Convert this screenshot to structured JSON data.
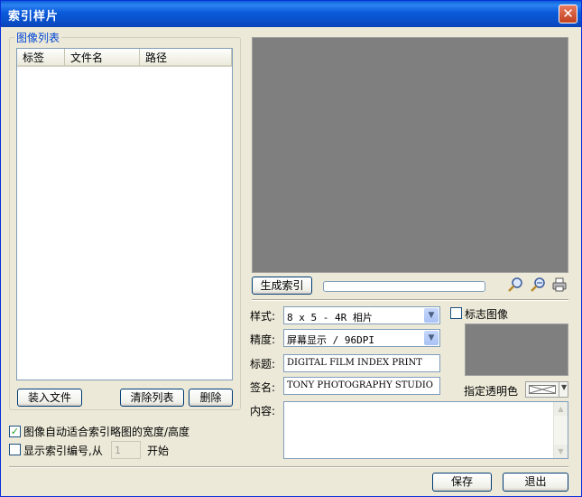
{
  "window": {
    "title": "索引样片",
    "close_glyph": "✕"
  },
  "image_list": {
    "group_label": "图像列表",
    "columns": [
      "标签",
      "文件名",
      "路径"
    ],
    "rows": []
  },
  "list_buttons": {
    "load": "装入文件",
    "clear": "清除列表",
    "delete": "删除"
  },
  "options": {
    "auto_fit_label": "图像自动适合索引略图的宽度/高度",
    "auto_fit_checked": true,
    "show_index_label": "显示索引编号,从",
    "show_index_checked": false,
    "start_value": "1",
    "start_suffix": "开始"
  },
  "preview": {
    "generate_button": "生成索引",
    "progress": 0
  },
  "form": {
    "style_label": "样式:",
    "style_value": "8 x 5 - 4R 相片",
    "precision_label": "精度:",
    "precision_value": "屏幕显示 / 96DPI",
    "title_label": "标题:",
    "title_value": "DIGITAL FILM INDEX PRINT",
    "signature_label": "签名:",
    "signature_value": "TONY PHOTOGRAPHY STUDIO",
    "content_label": "内容:",
    "content_value": ""
  },
  "logo": {
    "checkbox_label": "标志图像",
    "checked": false,
    "transparent_label": "指定透明色"
  },
  "footer": {
    "save": "保存",
    "exit": "退出"
  },
  "icons": {
    "zoom_in": "zoom-in-icon",
    "zoom_out": "zoom-out-icon",
    "print": "print-icon"
  },
  "colors": {
    "title_bar": "#0a5ad6",
    "preview_bg": "#7f7f7f",
    "group_label": "#0046d5",
    "dialog_bg": "#ece9d8"
  }
}
